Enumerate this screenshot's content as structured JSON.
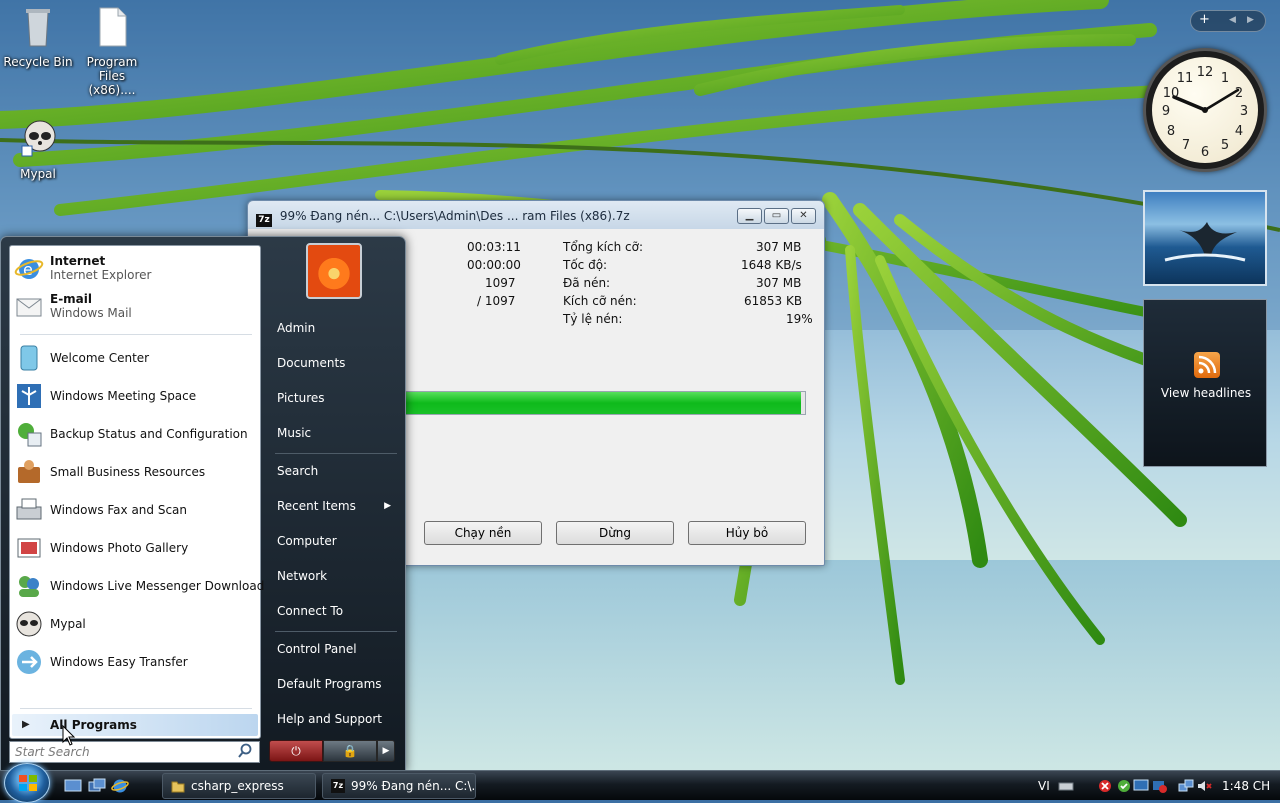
{
  "desktop": {
    "icons": [
      {
        "label": "Recycle Bin"
      },
      {
        "label": "Program Files (x86)...."
      },
      {
        "label": "Mypal"
      }
    ]
  },
  "zip_window": {
    "title": "99% Đang nén... C:\\Users\\Admin\\Des ... ram Files (x86).7z",
    "app_icon": "7z",
    "left_values": [
      "00:03:11",
      "00:00:00",
      "1097",
      "/ 1097"
    ],
    "stats": [
      {
        "label": "Tổng kích cỡ:",
        "value": "307 MB"
      },
      {
        "label": "Tốc độ:",
        "value": "1648 KB/s"
      },
      {
        "label": "Đã nén:",
        "value": "307 MB"
      },
      {
        "label": "Kích cỡ nén:",
        "value": "61853 KB"
      },
      {
        "label": "Tỷ lệ nén:",
        "value": "19%"
      }
    ],
    "progress_percent": 99,
    "buttons": {
      "background": "Chạy nền",
      "pause": "Dừng",
      "cancel": "Hủy bỏ"
    }
  },
  "start_menu": {
    "pinned": [
      {
        "title": "Internet",
        "subtitle": "Internet Explorer",
        "icon": "ie-icon"
      },
      {
        "title": "E-mail",
        "subtitle": "Windows Mail",
        "icon": "mail-icon"
      }
    ],
    "recent": [
      {
        "label": "Welcome Center",
        "icon": "welcome-center-icon"
      },
      {
        "label": "Windows Meeting Space",
        "icon": "meeting-space-icon"
      },
      {
        "label": "Backup Status and Configuration",
        "icon": "backup-icon"
      },
      {
        "label": "Small Business Resources",
        "icon": "business-icon"
      },
      {
        "label": "Windows Fax and Scan",
        "icon": "fax-icon"
      },
      {
        "label": "Windows Photo Gallery",
        "icon": "photo-gallery-icon"
      },
      {
        "label": "Windows Live Messenger Download",
        "icon": "messenger-icon"
      },
      {
        "label": "Mypal",
        "icon": "mypal-icon"
      },
      {
        "label": "Windows Easy Transfer",
        "icon": "easy-transfer-icon"
      }
    ],
    "all_programs": "All Programs",
    "search_placeholder": "Start Search",
    "right_items": {
      "group1": [
        "Admin",
        "Documents",
        "Pictures",
        "Music"
      ],
      "group2": [
        "Search",
        "Recent Items",
        "Computer",
        "Network",
        "Connect To"
      ],
      "group3": [
        "Control Panel",
        "Default Programs",
        "Help and Support"
      ]
    },
    "power_glyph": "⏻",
    "lock_glyph": "🔒",
    "more_glyph": "▶"
  },
  "taskbar": {
    "buttons": [
      {
        "label": "csharp_express"
      },
      {
        "label": "99% Đang nén... C:\\..."
      }
    ],
    "language": "VI",
    "time": "1:48 CH"
  },
  "gadgets": {
    "controls": [
      "+",
      "◀",
      "▶"
    ],
    "feed_label": "View headlines"
  },
  "colors": {
    "progress_green": "#0eba1b",
    "start_menu_bg": "#1a232c"
  }
}
